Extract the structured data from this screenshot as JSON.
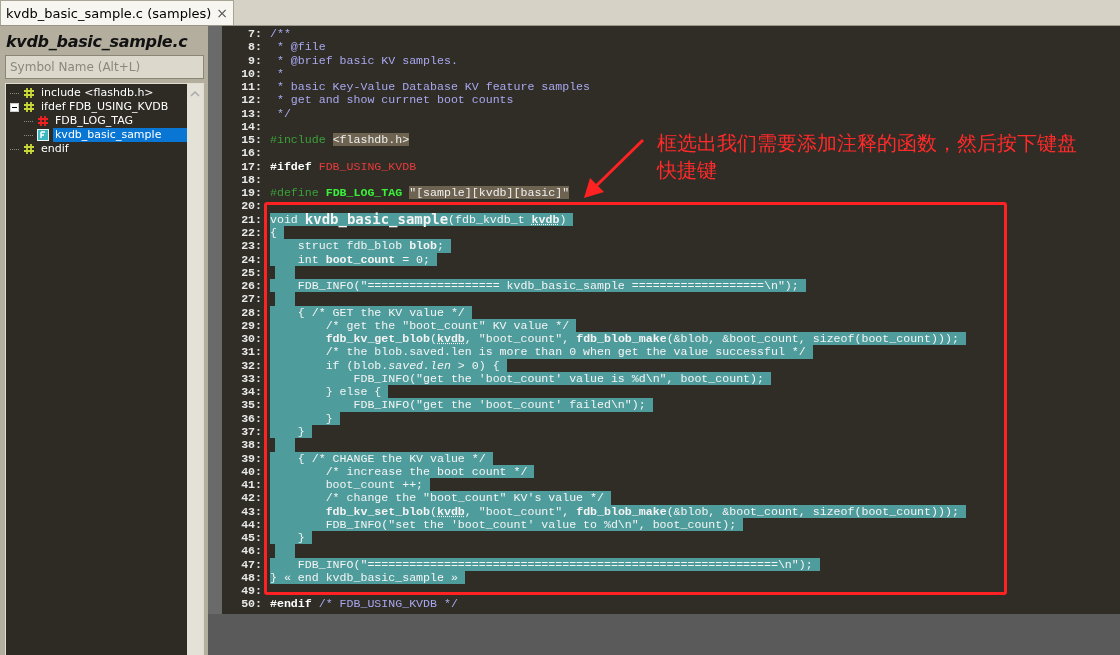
{
  "tab": {
    "title": "kvdb_basic_sample.c (samples)",
    "close": "×",
    "selected": true
  },
  "symbol_panel": {
    "title": "kvdb_basic_sample.c",
    "search": {
      "placeholder": "Symbol Name (Alt+L)"
    },
    "tree": [
      {
        "label": "include <flashdb.h>",
        "kind": "directive",
        "selected": false
      },
      {
        "label": "ifdef FDB_USING_KVDB",
        "kind": "directive",
        "selected": false,
        "expanded": true,
        "children": [
          {
            "label": "FDB_LOG_TAG",
            "kind": "macro",
            "selected": false
          },
          {
            "label": "kvdb_basic_sample",
            "kind": "function",
            "selected": true
          }
        ]
      },
      {
        "label": "endif",
        "kind": "directive",
        "selected": false
      }
    ]
  },
  "editor": {
    "lines": [
      {
        "number": "7:",
        "selected": false,
        "segments": [
          {
            "text": "/**",
            "kind": "comment"
          }
        ]
      },
      {
        "number": "8:",
        "selected": false,
        "segments": [
          {
            "text": " * @file",
            "kind": "comment"
          }
        ]
      },
      {
        "number": "9:",
        "selected": false,
        "segments": [
          {
            "text": " * @brief basic KV samples.",
            "kind": "comment"
          }
        ]
      },
      {
        "number": "10:",
        "selected": false,
        "segments": [
          {
            "text": " *",
            "kind": "comment"
          }
        ]
      },
      {
        "number": "11:",
        "selected": false,
        "segments": [
          {
            "text": " * basic Key-Value Database KV feature samples",
            "kind": "comment"
          }
        ]
      },
      {
        "number": "12:",
        "selected": false,
        "segments": [
          {
            "text": " * get and show currnet boot counts",
            "kind": "comment"
          }
        ]
      },
      {
        "number": "13:",
        "selected": false,
        "segments": [
          {
            "text": " */",
            "kind": "comment"
          }
        ]
      },
      {
        "number": "14:",
        "selected": false
      },
      {
        "number": "15:",
        "selected": false,
        "segments": [
          {
            "text": "#include ",
            "kind": "directive"
          },
          {
            "text": "<flashdb.h>",
            "kind": "literal"
          }
        ]
      },
      {
        "number": "16:",
        "selected": false
      },
      {
        "number": "17:",
        "selected": false,
        "segments": [
          {
            "text": "#ifdef ",
            "kind": "keyword"
          },
          {
            "text": "FDB_USING_KVDB",
            "kind": "macro"
          }
        ]
      },
      {
        "number": "18:",
        "selected": false
      },
      {
        "number": "19:",
        "selected": false,
        "segments": [
          {
            "text": "#define ",
            "kind": "directive"
          },
          {
            "text": "FDB_LOG_TAG ",
            "kind": "macro-def"
          },
          {
            "text": "\"[sample][kvdb][basic]\"",
            "kind": "literal"
          }
        ]
      },
      {
        "number": "20:",
        "selected": false
      },
      {
        "number": "21:",
        "selected": true,
        "segments": [
          {
            "text": "void ",
            "kind": "plain"
          },
          {
            "text": "kvdb_basic_sample",
            "kind": "func-def"
          },
          {
            "text": "(fdb_kvdb_t ",
            "kind": "plain"
          },
          {
            "text": "kvdb",
            "kind": "param"
          },
          {
            "text": ")",
            "kind": "plain"
          }
        ]
      },
      {
        "number": "22:",
        "selected": true,
        "segments": [
          {
            "text": "{",
            "kind": "plain"
          }
        ]
      },
      {
        "number": "23:",
        "selected": true,
        "segments": [
          {
            "text": "    struct fdb_blob ",
            "kind": "plain"
          },
          {
            "text": "blob",
            "kind": "bold"
          },
          {
            "text": ";",
            "kind": "plain"
          }
        ]
      },
      {
        "number": "24:",
        "selected": true,
        "segments": [
          {
            "text": "    int ",
            "kind": "plain"
          },
          {
            "text": "boot_count",
            "kind": "bold"
          },
          {
            "text": " = 0;",
            "kind": "plain"
          }
        ]
      },
      {
        "number": "25:",
        "selected": true
      },
      {
        "number": "26:",
        "selected": true,
        "segments": [
          {
            "text": "    FDB_INFO(\"=================== kvdb_basic_sample ===================\\n\");",
            "kind": "plain"
          }
        ]
      },
      {
        "number": "27:",
        "selected": true
      },
      {
        "number": "28:",
        "selected": true,
        "segments": [
          {
            "text": "    { /* GET the KV value */",
            "kind": "plain"
          }
        ]
      },
      {
        "number": "29:",
        "selected": true,
        "segments": [
          {
            "text": "        /* get the \"boot_count\" KV value */",
            "kind": "plain"
          }
        ]
      },
      {
        "number": "30:",
        "selected": true,
        "segments": [
          {
            "text": "        fdb_kv_get_blob",
            "kind": "bold"
          },
          {
            "text": "(",
            "kind": "plain"
          },
          {
            "text": "kvdb",
            "kind": "param"
          },
          {
            "text": ", \"boot_count\", ",
            "kind": "plain"
          },
          {
            "text": "fdb_blob_make",
            "kind": "bold"
          },
          {
            "text": "(&blob, &boot_count, sizeof(boot_count)));",
            "kind": "plain"
          }
        ]
      },
      {
        "number": "31:",
        "selected": true,
        "segments": [
          {
            "text": "        /* the blob.saved.len is more than 0 when get the value successful */",
            "kind": "plain"
          }
        ]
      },
      {
        "number": "32:",
        "selected": true,
        "segments": [
          {
            "text": "        if (blob.",
            "kind": "plain"
          },
          {
            "text": "saved.len",
            "kind": "italic"
          },
          {
            "text": " > 0) {",
            "kind": "plain"
          }
        ]
      },
      {
        "number": "33:",
        "selected": true,
        "segments": [
          {
            "text": "            FDB_INFO(\"get the 'boot_count' value is %d\\n\", boot_count);",
            "kind": "plain"
          }
        ]
      },
      {
        "number": "34:",
        "selected": true,
        "segments": [
          {
            "text": "        } else {",
            "kind": "plain"
          }
        ]
      },
      {
        "number": "35:",
        "selected": true,
        "segments": [
          {
            "text": "            FDB_INFO(\"get the 'boot_count' failed\\n\");",
            "kind": "plain"
          }
        ]
      },
      {
        "number": "36:",
        "selected": true,
        "segments": [
          {
            "text": "        }",
            "kind": "plain"
          }
        ]
      },
      {
        "number": "37:",
        "selected": true,
        "segments": [
          {
            "text": "    }",
            "kind": "plain"
          }
        ]
      },
      {
        "number": "38:",
        "selected": true
      },
      {
        "number": "39:",
        "selected": true,
        "segments": [
          {
            "text": "    { /* CHANGE the KV value */",
            "kind": "plain"
          }
        ]
      },
      {
        "number": "40:",
        "selected": true,
        "segments": [
          {
            "text": "        /* increase the boot count */",
            "kind": "plain"
          }
        ]
      },
      {
        "number": "41:",
        "selected": true,
        "segments": [
          {
            "text": "        boot_count ++;",
            "kind": "plain"
          }
        ]
      },
      {
        "number": "42:",
        "selected": true,
        "segments": [
          {
            "text": "        /* change the \"boot_count\" KV's value */",
            "kind": "plain"
          }
        ]
      },
      {
        "number": "43:",
        "selected": true,
        "segments": [
          {
            "text": "        fdb_kv_set_blob",
            "kind": "bold"
          },
          {
            "text": "(",
            "kind": "plain"
          },
          {
            "text": "kvdb",
            "kind": "param"
          },
          {
            "text": ", \"boot_count\", ",
            "kind": "plain"
          },
          {
            "text": "fdb_blob_make",
            "kind": "bold"
          },
          {
            "text": "(&blob, &boot_count, sizeof(boot_count)));",
            "kind": "plain"
          }
        ]
      },
      {
        "number": "44:",
        "selected": true,
        "segments": [
          {
            "text": "        FDB_INFO(\"set the 'boot_count' value to %d\\n\", boot_count);",
            "kind": "plain"
          }
        ]
      },
      {
        "number": "45:",
        "selected": true,
        "segments": [
          {
            "text": "    }",
            "kind": "plain"
          }
        ]
      },
      {
        "number": "46:",
        "selected": true
      },
      {
        "number": "47:",
        "selected": true,
        "segments": [
          {
            "text": "    FDB_INFO(\"===========================================================\\n\");",
            "kind": "plain"
          }
        ]
      },
      {
        "number": "48:",
        "selected": true,
        "segments": [
          {
            "text": "} « end kvdb_basic_sample »",
            "kind": "plain"
          }
        ]
      },
      {
        "number": "49:",
        "selected": false
      },
      {
        "number": "50:",
        "selected": false,
        "segments": [
          {
            "text": "#endif ",
            "kind": "keyword"
          },
          {
            "text": "/* FDB_USING_KVDB */",
            "kind": "comment"
          }
        ]
      }
    ]
  },
  "annotation": {
    "text": "框选出我们需要添加注释的函数，然后按下键盘快捷键"
  }
}
